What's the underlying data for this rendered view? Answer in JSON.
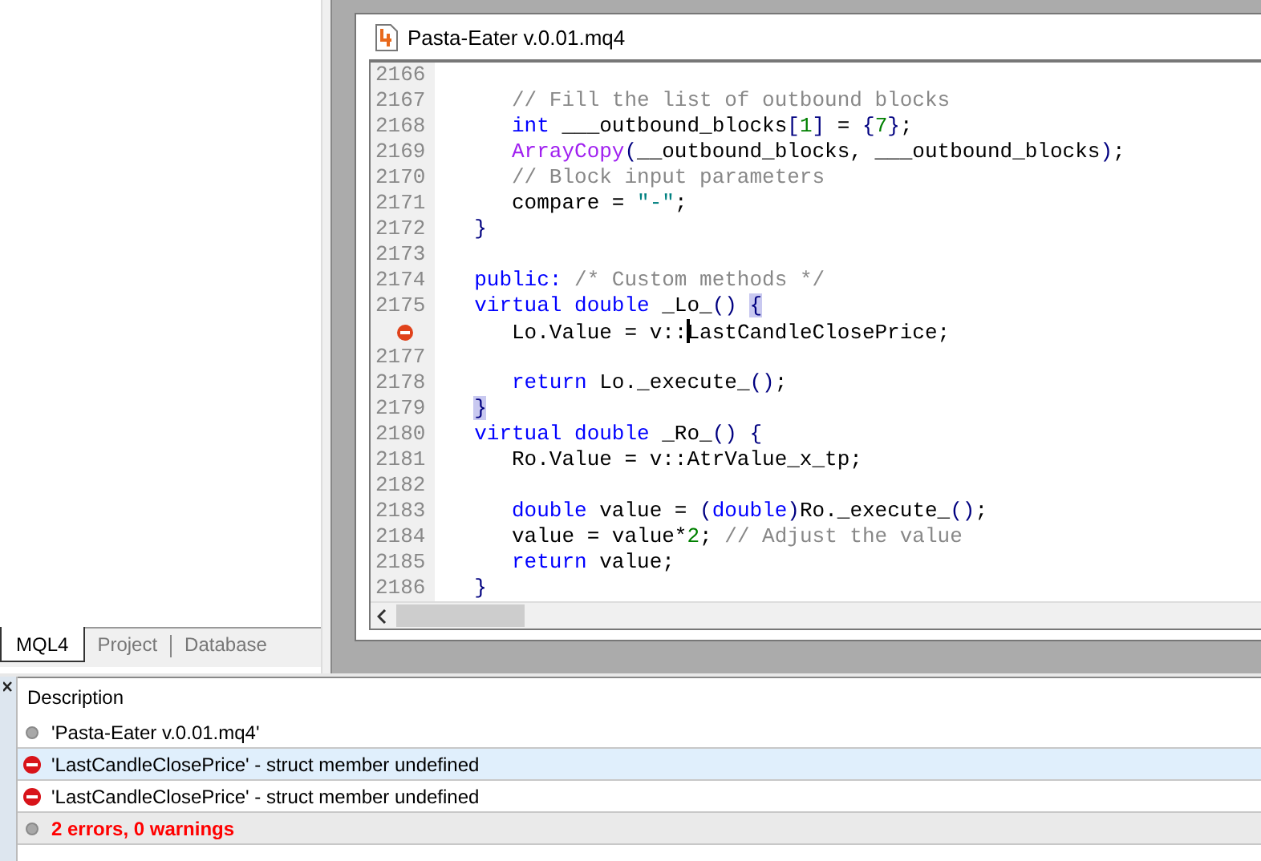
{
  "navigator": {
    "tabs": [
      {
        "label": "MQL4",
        "selected": true
      },
      {
        "label": "Project",
        "selected": false
      },
      {
        "label": "Database",
        "selected": false
      }
    ]
  },
  "editor": {
    "title": "Pasta-Eater v.0.01.mq4",
    "lines": [
      {
        "number": "2166",
        "error": false
      },
      {
        "number": "2167",
        "error": false,
        "tokens": [
          {
            "text": "     // Fill the list of outbound blocks",
            "kind": "comment"
          }
        ]
      },
      {
        "number": "2168",
        "error": false,
        "tokens": [
          {
            "text": "     int",
            "kind": "keyword"
          },
          {
            "text": " ___outbound_blocks",
            "kind": "plain"
          },
          {
            "text": "[",
            "kind": "op"
          },
          {
            "text": "1",
            "kind": "number"
          },
          {
            "text": "]",
            "kind": "op"
          },
          {
            "text": " = ",
            "kind": "plain"
          },
          {
            "text": "{",
            "kind": "op"
          },
          {
            "text": "7",
            "kind": "number"
          },
          {
            "text": "}",
            "kind": "op"
          },
          {
            "text": ";",
            "kind": "plain"
          }
        ]
      },
      {
        "number": "2169",
        "error": false,
        "tokens": [
          {
            "text": "     ArrayCopy",
            "kind": "function"
          },
          {
            "text": "(",
            "kind": "op"
          },
          {
            "text": "__outbound_blocks, ___outbound_blocks",
            "kind": "plain"
          },
          {
            "text": ")",
            "kind": "op"
          },
          {
            "text": ";",
            "kind": "plain"
          }
        ]
      },
      {
        "number": "2170",
        "error": false,
        "tokens": [
          {
            "text": "     // Block input parameters",
            "kind": "comment"
          }
        ]
      },
      {
        "number": "2171",
        "error": false,
        "tokens": [
          {
            "text": "     compare = ",
            "kind": "plain"
          },
          {
            "text": "\"-\"",
            "kind": "string"
          },
          {
            "text": ";",
            "kind": "plain"
          }
        ]
      },
      {
        "number": "2172",
        "error": false,
        "tokens": [
          {
            "text": "  }",
            "kind": "op"
          }
        ]
      },
      {
        "number": "2173",
        "error": false
      },
      {
        "number": "2174",
        "error": false,
        "tokens": [
          {
            "text": "  public:",
            "kind": "keyword"
          },
          {
            "text": " /* Custom methods */",
            "kind": "comment"
          }
        ]
      },
      {
        "number": "2175",
        "error": false,
        "tokens": [
          {
            "text": "  virtual ",
            "kind": "keyword"
          },
          {
            "text": "double",
            "kind": "keyword"
          },
          {
            "text": " _Lo_",
            "kind": "plain"
          },
          {
            "text": "() ",
            "kind": "op"
          },
          {
            "text": "{",
            "kind": "op",
            "brace_match": true
          }
        ]
      },
      {
        "error": true,
        "tokens": [
          {
            "text": "     Lo.Value = v::",
            "kind": "plain"
          },
          {
            "text": "LastCandleClosePrice;",
            "kind": "plain",
            "cursor_before": true
          }
        ]
      },
      {
        "number": "2177",
        "error": false
      },
      {
        "number": "2178",
        "error": false,
        "tokens": [
          {
            "text": "     return",
            "kind": "keyword"
          },
          {
            "text": " Lo._execute_",
            "kind": "plain"
          },
          {
            "text": "()",
            "kind": "op"
          },
          {
            "text": ";",
            "kind": "plain"
          }
        ]
      },
      {
        "number": "2179",
        "error": false,
        "tokens": [
          {
            "text": "  }",
            "kind": "op",
            "brace_match": true
          }
        ]
      },
      {
        "number": "2180",
        "error": false,
        "tokens": [
          {
            "text": "  virtual ",
            "kind": "keyword"
          },
          {
            "text": "double",
            "kind": "keyword"
          },
          {
            "text": " _Ro_",
            "kind": "plain"
          },
          {
            "text": "() {",
            "kind": "op"
          }
        ]
      },
      {
        "number": "2181",
        "error": false,
        "tokens": [
          {
            "text": "     Ro.Value = v::AtrValue_x_tp;",
            "kind": "plain"
          }
        ]
      },
      {
        "number": "2182",
        "error": false
      },
      {
        "number": "2183",
        "error": false,
        "tokens": [
          {
            "text": "     double",
            "kind": "keyword"
          },
          {
            "text": " value = ",
            "kind": "plain"
          },
          {
            "text": "(",
            "kind": "op"
          },
          {
            "text": "double",
            "kind": "keyword"
          },
          {
            "text": ")",
            "kind": "op"
          },
          {
            "text": "Ro._execute_",
            "kind": "plain"
          },
          {
            "text": "()",
            "kind": "op"
          },
          {
            "text": ";",
            "kind": "plain"
          }
        ]
      },
      {
        "number": "2184",
        "error": false,
        "tokens": [
          {
            "text": "     value = value*",
            "kind": "plain"
          },
          {
            "text": "2",
            "kind": "number"
          },
          {
            "text": "; ",
            "kind": "plain"
          },
          {
            "text": "// Adjust the value",
            "kind": "comment"
          }
        ]
      },
      {
        "number": "2185",
        "error": false,
        "tokens": [
          {
            "text": "     return",
            "kind": "keyword"
          },
          {
            "text": " value;",
            "kind": "plain"
          }
        ]
      },
      {
        "number": "2186",
        "error": false,
        "tokens": [
          {
            "text": "  }",
            "kind": "op"
          }
        ]
      }
    ]
  },
  "errors_panel": {
    "header": "Description",
    "rows": [
      {
        "kind": "info",
        "text": "'Pasta-Eater v.0.01.mq4'",
        "selected": false
      },
      {
        "kind": "error",
        "text": "'LastCandleClosePrice' - struct member undefined",
        "selected": true
      },
      {
        "kind": "error",
        "text": "'LastCandleClosePrice' - struct member undefined",
        "selected": false
      },
      {
        "kind": "summary",
        "text": "2 errors, 0 warnings",
        "selected": false
      }
    ]
  }
}
